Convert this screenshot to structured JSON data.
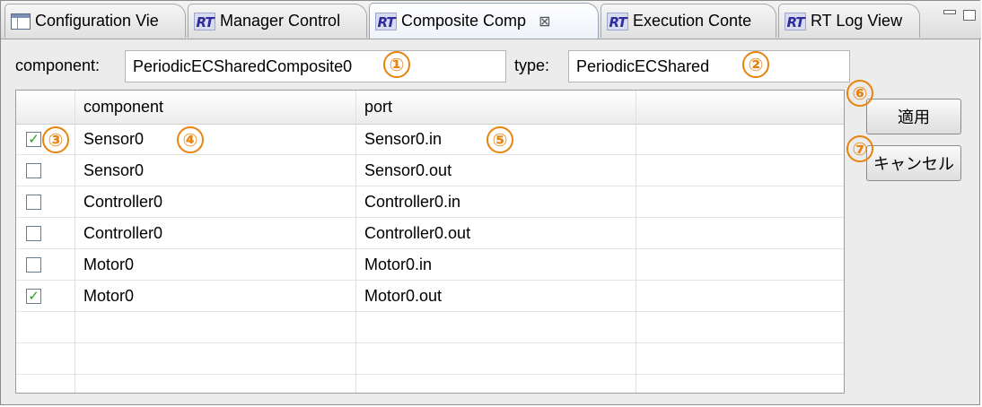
{
  "tabs": [
    {
      "label": "Configuration Vie",
      "icon": "table-icon"
    },
    {
      "label": "Manager Control",
      "icon": "rt-icon"
    },
    {
      "label": "Composite Comp",
      "icon": "rt-icon",
      "active": true,
      "close": "⊠"
    },
    {
      "label": "Execution Conte",
      "icon": "rt-icon"
    },
    {
      "label": "RT Log View",
      "icon": "rt-icon"
    }
  ],
  "icon_text": "RT",
  "form": {
    "component_label": "component:",
    "component_value": "PeriodicECSharedComposite0",
    "type_label": "type:",
    "type_value": "PeriodicECShared"
  },
  "table": {
    "headers": [
      "",
      "component",
      "port",
      ""
    ],
    "rows": [
      {
        "checked": true,
        "component": "Sensor0",
        "port": "Sensor0.in"
      },
      {
        "checked": false,
        "component": "Sensor0",
        "port": "Sensor0.out"
      },
      {
        "checked": false,
        "component": "Controller0",
        "port": "Controller0.in"
      },
      {
        "checked": false,
        "component": "Controller0",
        "port": "Controller0.out"
      },
      {
        "checked": false,
        "component": "Motor0",
        "port": "Motor0.in"
      },
      {
        "checked": true,
        "component": "Motor0",
        "port": "Motor0.out"
      }
    ]
  },
  "buttons": {
    "apply": "適用",
    "cancel": "キャンセル"
  },
  "markers": [
    "①",
    "②",
    "③",
    "④",
    "⑤",
    "⑥",
    "⑦"
  ],
  "colors": {
    "marker": "#e8830e",
    "check": "#2a9a2a"
  }
}
